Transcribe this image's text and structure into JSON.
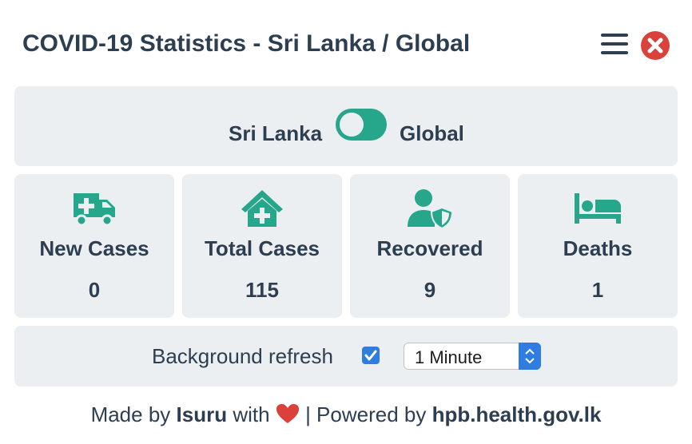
{
  "header": {
    "title": "COVID-19 Statistics - Sri Lanka / Global",
    "menu_icon": "hamburger-menu-icon",
    "close_icon": "close-circle-icon"
  },
  "toggle": {
    "left_label": "Sri Lanka",
    "right_label": "Global",
    "state": "off"
  },
  "stats": [
    {
      "label": "New Cases",
      "value": "0",
      "icon": "ambulance-icon"
    },
    {
      "label": "Total Cases",
      "value": "115",
      "icon": "hospital-icon"
    },
    {
      "label": "Recovered",
      "value": "9",
      "icon": "user-shield-icon"
    },
    {
      "label": "Deaths",
      "value": "1",
      "icon": "bed-icon"
    }
  ],
  "refresh": {
    "label": "Background refresh",
    "checked": true,
    "interval": "1 Minute"
  },
  "footer": {
    "made_by": "Made by",
    "author": "Isuru",
    "with": "with",
    "powered_by": "| Powered by",
    "source": "hpb.health.gov.lk"
  },
  "colors": {
    "accent": "#26a68a",
    "text": "#2c3e50",
    "panel": "#eceff1",
    "close": "#d9413a",
    "heart": "#d9413a",
    "checkbox": "#2f7de1"
  }
}
